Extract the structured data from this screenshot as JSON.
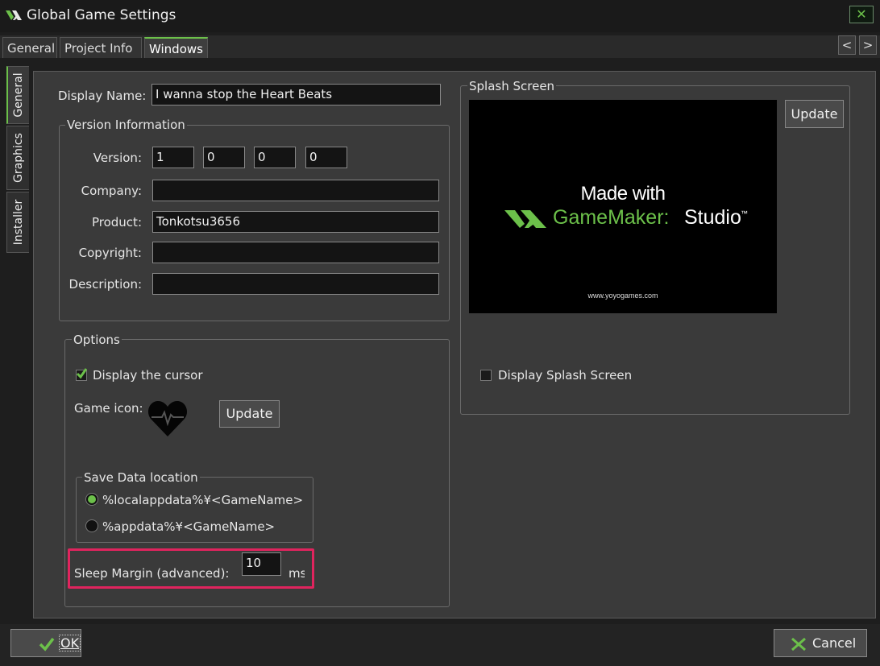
{
  "window": {
    "title": "Global Game Settings",
    "logo": "gamemaker-logo",
    "close_icon": "close-icon"
  },
  "top_tabs": [
    {
      "label": "General",
      "active": false
    },
    {
      "label": "Project Info",
      "active": false
    },
    {
      "label": "Windows",
      "active": true
    }
  ],
  "nav": {
    "prev": "<",
    "next": ">"
  },
  "side_tabs": [
    {
      "label": "General",
      "active": true
    },
    {
      "label": "Graphics",
      "active": false
    },
    {
      "label": "Installer",
      "active": false
    }
  ],
  "display_name": {
    "label": "Display Name:",
    "value": "I wanna stop the Heart Beats"
  },
  "version_info": {
    "legend": "Version Information",
    "version_label": "Version:",
    "version": [
      "1",
      "0",
      "0",
      "0"
    ],
    "company_label": "Company:",
    "company": "",
    "product_label": "Product:",
    "product": "Tonkotsu3656",
    "copyright_label": "Copyright:",
    "copyright": "",
    "description_label": "Description:",
    "description": ""
  },
  "options": {
    "legend": "Options",
    "display_cursor_label": "Display the cursor",
    "display_cursor_checked": true,
    "game_icon_label": "Game icon:",
    "game_icon": "heart-beat-icon",
    "update_label": "Update",
    "save_data": {
      "legend": "Save Data location",
      "options": [
        "%localappdata%¥<GameName>",
        "%appdata%¥<GameName>"
      ],
      "selected": 0
    },
    "sleep_margin_label": "Sleep Margin (advanced):",
    "sleep_margin_value": "10",
    "sleep_margin_unit": "ms"
  },
  "splash": {
    "legend": "Splash Screen",
    "update_label": "Update",
    "image_line1": "Made with",
    "image_brand": "GameMaker:",
    "image_brand2": "Studio",
    "image_tm": "™",
    "image_url": "www.yoyogames.com",
    "display_label": "Display Splash Screen",
    "display_checked": false
  },
  "footer": {
    "ok_label": "OK",
    "cancel_label": "Cancel"
  },
  "colors": {
    "accent": "#6cc04a",
    "highlight": "#e0245e",
    "panel": "#3a3a3a",
    "field": "#141414"
  }
}
